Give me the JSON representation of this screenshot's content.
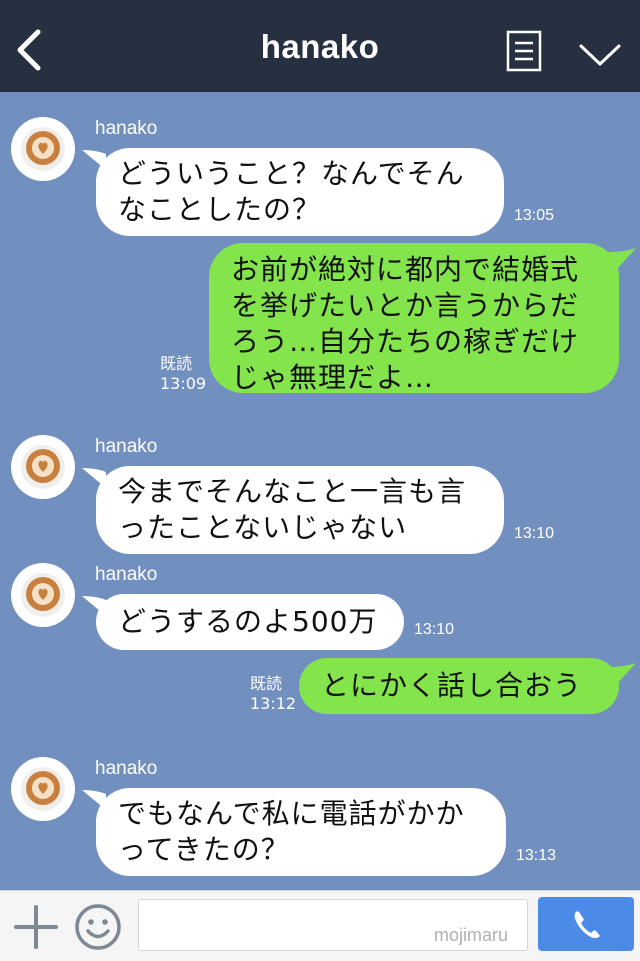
{
  "header": {
    "title": "hanako"
  },
  "messages": [
    {
      "sender": "hanako",
      "lines": [
        "どういうこと？なんでそん",
        "なことしたの？"
      ],
      "time": "13:05"
    },
    {
      "lines": [
        "お前が絶対に都内で結婚式",
        "を挙げたいとか言うからだ",
        "ろう…自分たちの稼ぎだけ",
        "じゃ無理だよ…"
      ],
      "read": "既読",
      "time": "13:09"
    },
    {
      "sender": "hanako",
      "lines": [
        "今までそんなこと一言も言",
        "ったことないじゃない"
      ],
      "time": "13:10"
    },
    {
      "sender": "hanako",
      "lines": [
        "どうするのよ500万"
      ],
      "time": "13:10"
    },
    {
      "lines": [
        "とにかく話し合おう"
      ],
      "read": "既読",
      "time": "13:12"
    },
    {
      "sender": "hanako",
      "lines": [
        "でもなんで私に電話がかか",
        "ってきたの？"
      ],
      "time": "13:13"
    }
  ],
  "footer": {
    "input_value": "",
    "watermark": "mojimaru"
  },
  "colors": {
    "header": "#263040",
    "chat_bg": "#7290bf",
    "outgoing": "#83e44c",
    "incoming": "#ffffff",
    "call_button": "#4c8ae8"
  },
  "icons": {
    "back": "chevron-left-icon",
    "menu": "notes-icon",
    "collapse": "chevron-down-icon",
    "add": "plus-icon",
    "emoji": "smiley-icon",
    "call": "phone-icon"
  }
}
